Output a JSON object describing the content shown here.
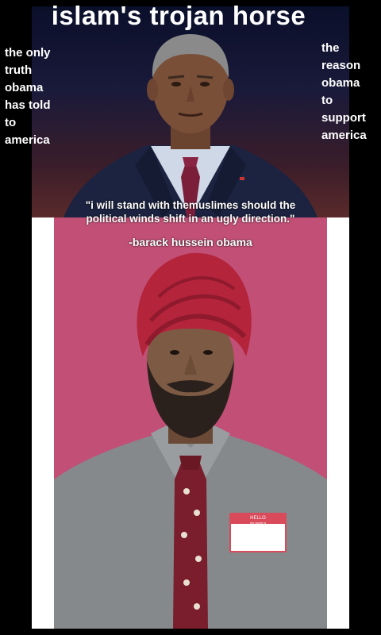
{
  "meme": {
    "title": "islam's trojan horse",
    "left_caption": [
      "the only",
      "truth",
      "obama",
      "has told",
      "to",
      "america"
    ],
    "right_caption": [
      "the",
      "reason",
      "obama",
      "to",
      "support",
      "america"
    ],
    "quote_lines": [
      "\"i will stand with themuslimes should the",
      "political winds shift in an ugly direction.\""
    ],
    "attribution": "-barack hussein obama",
    "name_tag": {
      "hello": "HELLO",
      "subtitle": "my name is"
    }
  }
}
